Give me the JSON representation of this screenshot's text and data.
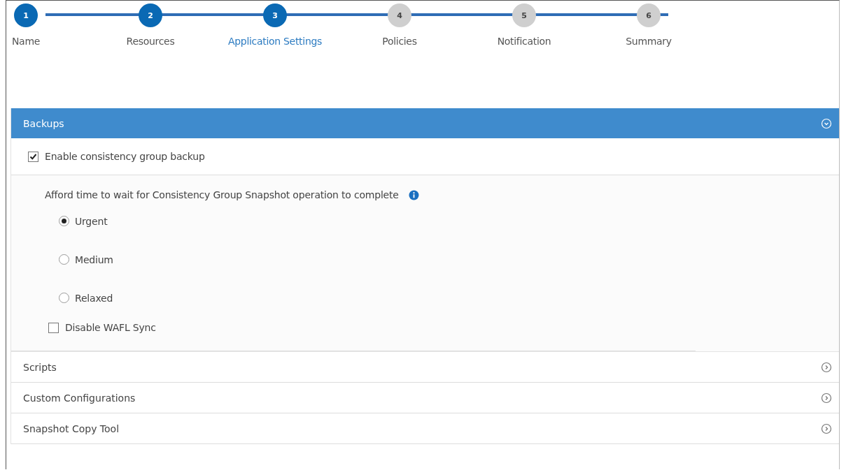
{
  "steps": [
    {
      "number": "1",
      "label": "Name",
      "completed": true,
      "selected": false
    },
    {
      "number": "2",
      "label": "Resources",
      "completed": true,
      "selected": false
    },
    {
      "number": "3",
      "label": "Application Settings",
      "completed": true,
      "selected": true
    },
    {
      "number": "4",
      "label": "Policies",
      "completed": false,
      "selected": false
    },
    {
      "number": "5",
      "label": "Notification",
      "completed": false,
      "selected": false
    },
    {
      "number": "6",
      "label": "Summary",
      "completed": false,
      "selected": false
    }
  ],
  "sections": [
    {
      "title": "Backups",
      "expanded": true
    },
    {
      "title": "Scripts",
      "expanded": false
    },
    {
      "title": "Custom Configurations",
      "expanded": false
    },
    {
      "title": "Snapshot Copy Tool",
      "expanded": false
    }
  ],
  "backups": {
    "consistency_group": {
      "label": "Enable consistency group backup",
      "checked": true
    },
    "wait_prompt": "Afford time to wait for Consistency Group Snapshot operation to complete",
    "wait_options": [
      {
        "label": "Urgent",
        "selected": true
      },
      {
        "label": "Medium",
        "selected": false
      },
      {
        "label": "Relaxed",
        "selected": false
      }
    ],
    "disable_wafl": {
      "label": "Disable WAFL Sync",
      "checked": false
    }
  }
}
